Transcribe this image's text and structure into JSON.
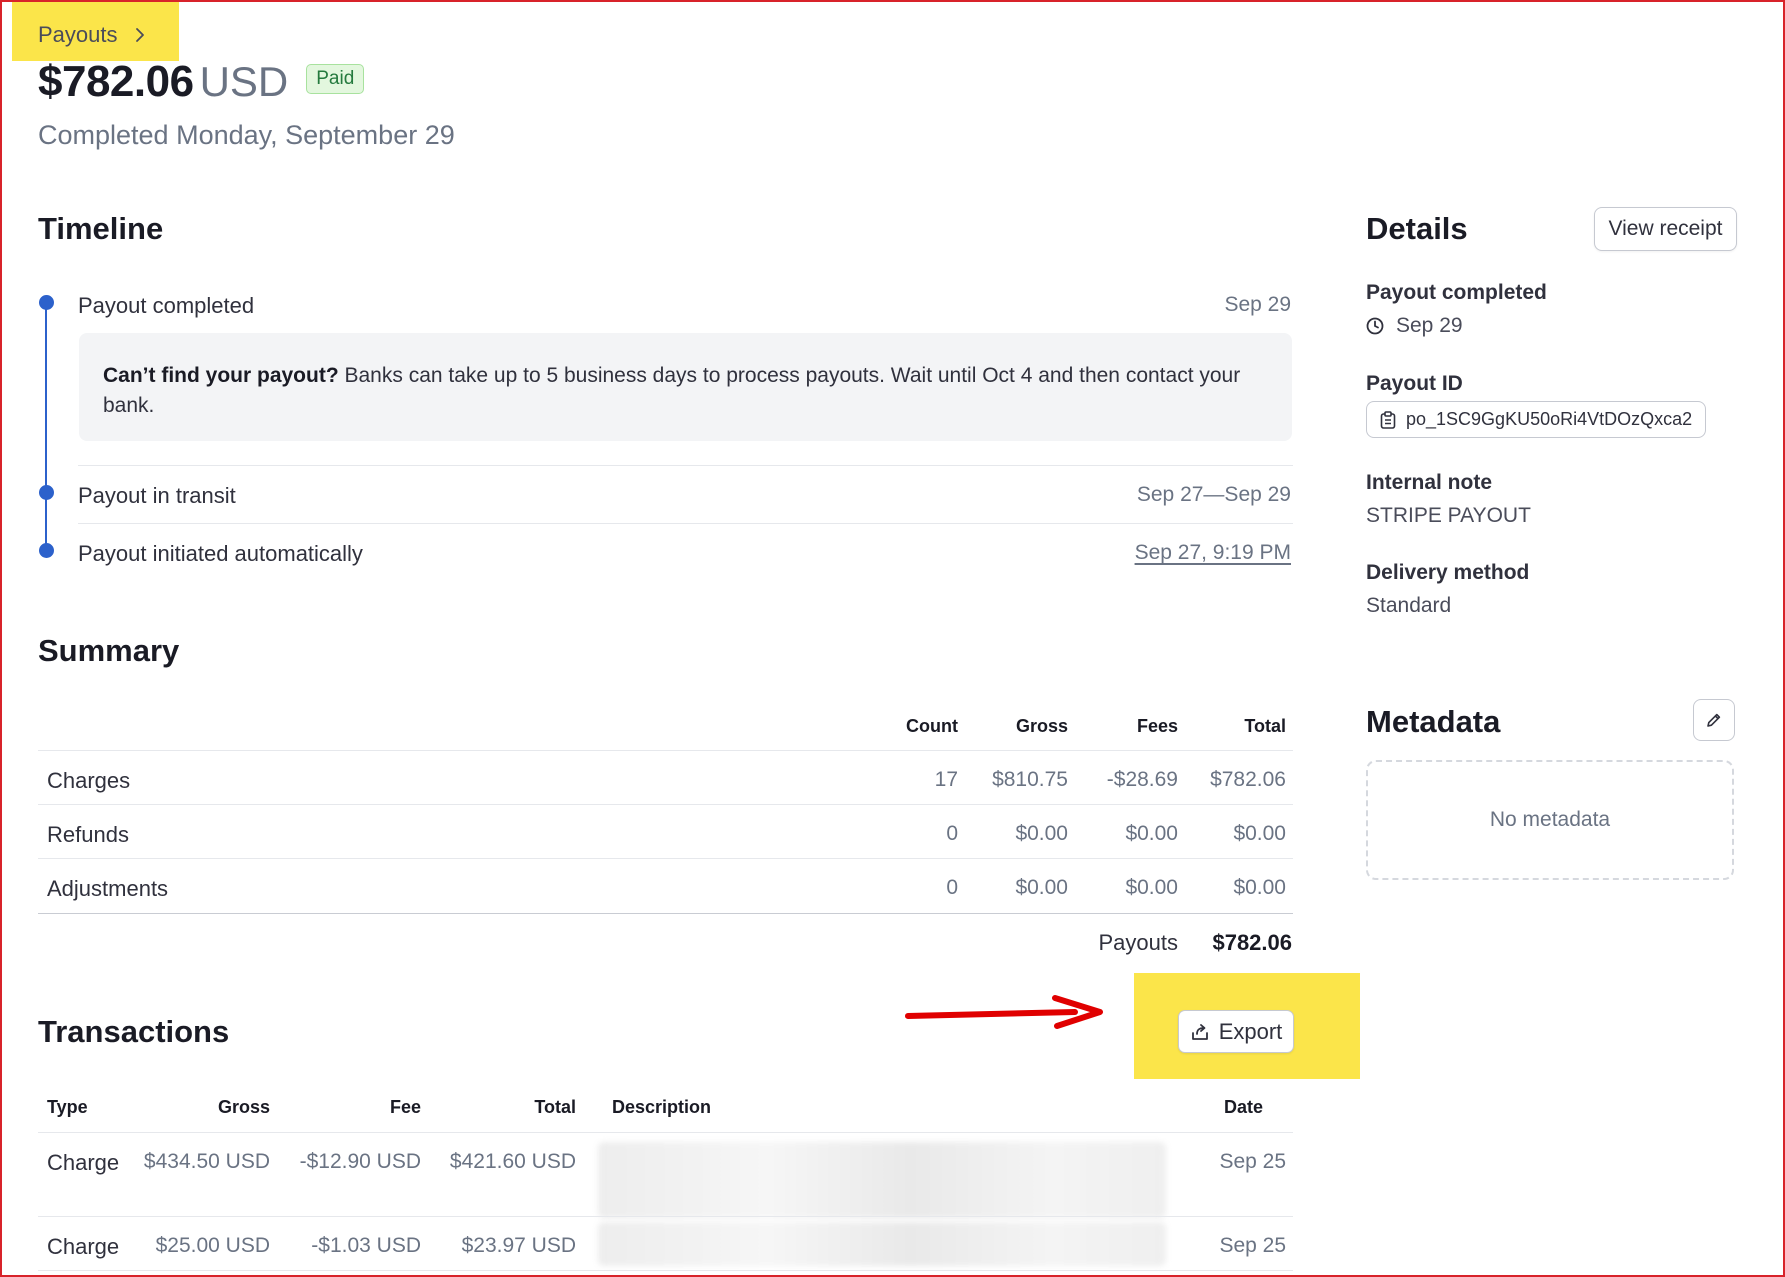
{
  "breadcrumb": {
    "label": "Payouts"
  },
  "payout": {
    "amount": "$782.06",
    "currency": "USD",
    "status": "Paid",
    "completed_text": "Completed Monday, September 29"
  },
  "timeline": {
    "title": "Timeline",
    "events": [
      {
        "label": "Payout completed",
        "date": "Sep 29"
      },
      {
        "label": "Payout in transit",
        "date": "Sep 27—Sep 29"
      },
      {
        "label": "Payout initiated automatically",
        "date": "Sep 27, 9:19 PM"
      }
    ],
    "notice": {
      "bold": "Can’t find your payout?",
      "text": " Banks can take up to 5 business days to process payouts. Wait until Oct 4 and then contact your bank."
    }
  },
  "summary": {
    "title": "Summary",
    "columns": [
      "Count",
      "Gross",
      "Fees",
      "Total"
    ],
    "rows": [
      {
        "label": "Charges",
        "count": "17",
        "gross": "$810.75",
        "fees": "-$28.69",
        "total": "$782.06"
      },
      {
        "label": "Refunds",
        "count": "0",
        "gross": "$0.00",
        "fees": "$0.00",
        "total": "$0.00"
      },
      {
        "label": "Adjustments",
        "count": "0",
        "gross": "$0.00",
        "fees": "$0.00",
        "total": "$0.00"
      }
    ],
    "payouts_label": "Payouts",
    "payouts_total": "$782.06"
  },
  "transactions": {
    "title": "Transactions",
    "export_label": "Export",
    "columns": [
      "Type",
      "Gross",
      "Fee",
      "Total",
      "Description",
      "Date"
    ],
    "rows": [
      {
        "type": "Charge",
        "gross": "$434.50 USD",
        "fee": "-$12.90 USD",
        "total": "$421.60 USD",
        "date": "Sep 25"
      },
      {
        "type": "Charge",
        "gross": "$25.00 USD",
        "fee": "-$1.03 USD",
        "total": "$23.97 USD",
        "date": "Sep 25"
      }
    ]
  },
  "details": {
    "title": "Details",
    "view_receipt_label": "View receipt",
    "payout_completed_label": "Payout completed",
    "payout_completed_date": "Sep 29",
    "payout_id_label": "Payout ID",
    "payout_id": "po_1SC9GgKU50oRi4VtDOzQxca2",
    "internal_note_label": "Internal note",
    "internal_note": "STRIPE PAYOUT",
    "delivery_method_label": "Delivery method",
    "delivery_method": "Standard"
  },
  "metadata": {
    "title": "Metadata",
    "empty_text": "No metadata"
  },
  "colors": {
    "accent_blue": "#2c61cb",
    "highlight_yellow": "#fbe54a",
    "annotation_red": "#e00000",
    "paid_green": "#257a3e"
  }
}
